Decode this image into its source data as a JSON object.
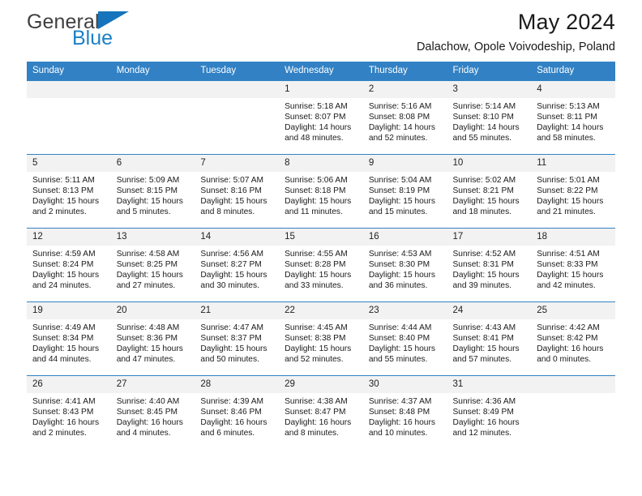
{
  "brand": {
    "name_top": "General",
    "name_bottom": "Blue",
    "triangle_color": "#1574bb",
    "top_color": "#3f3f3f",
    "bottom_color": "#1d80c6"
  },
  "header": {
    "title": "May 2024",
    "subtitle": "Dalachow, Opole Voivodeship, Poland"
  },
  "calendar": {
    "header_bg": "#3281c4",
    "header_text": "#ffffff",
    "daynum_bg": "#f2f2f2",
    "weekdays": [
      "Sunday",
      "Monday",
      "Tuesday",
      "Wednesday",
      "Thursday",
      "Friday",
      "Saturday"
    ],
    "labels": {
      "sunrise": "Sunrise:",
      "sunset": "Sunset:",
      "daylight": "Daylight:"
    },
    "weeks": [
      [
        {
          "day": "",
          "sunrise": "",
          "sunset": "",
          "daylight_line1": "",
          "daylight_line2": ""
        },
        {
          "day": "",
          "sunrise": "",
          "sunset": "",
          "daylight_line1": "",
          "daylight_line2": ""
        },
        {
          "day": "",
          "sunrise": "",
          "sunset": "",
          "daylight_line1": "",
          "daylight_line2": ""
        },
        {
          "day": "1",
          "sunrise": "Sunrise: 5:18 AM",
          "sunset": "Sunset: 8:07 PM",
          "daylight_line1": "Daylight: 14 hours",
          "daylight_line2": "and 48 minutes."
        },
        {
          "day": "2",
          "sunrise": "Sunrise: 5:16 AM",
          "sunset": "Sunset: 8:08 PM",
          "daylight_line1": "Daylight: 14 hours",
          "daylight_line2": "and 52 minutes."
        },
        {
          "day": "3",
          "sunrise": "Sunrise: 5:14 AM",
          "sunset": "Sunset: 8:10 PM",
          "daylight_line1": "Daylight: 14 hours",
          "daylight_line2": "and 55 minutes."
        },
        {
          "day": "4",
          "sunrise": "Sunrise: 5:13 AM",
          "sunset": "Sunset: 8:11 PM",
          "daylight_line1": "Daylight: 14 hours",
          "daylight_line2": "and 58 minutes."
        }
      ],
      [
        {
          "day": "5",
          "sunrise": "Sunrise: 5:11 AM",
          "sunset": "Sunset: 8:13 PM",
          "daylight_line1": "Daylight: 15 hours",
          "daylight_line2": "and 2 minutes."
        },
        {
          "day": "6",
          "sunrise": "Sunrise: 5:09 AM",
          "sunset": "Sunset: 8:15 PM",
          "daylight_line1": "Daylight: 15 hours",
          "daylight_line2": "and 5 minutes."
        },
        {
          "day": "7",
          "sunrise": "Sunrise: 5:07 AM",
          "sunset": "Sunset: 8:16 PM",
          "daylight_line1": "Daylight: 15 hours",
          "daylight_line2": "and 8 minutes."
        },
        {
          "day": "8",
          "sunrise": "Sunrise: 5:06 AM",
          "sunset": "Sunset: 8:18 PM",
          "daylight_line1": "Daylight: 15 hours",
          "daylight_line2": "and 11 minutes."
        },
        {
          "day": "9",
          "sunrise": "Sunrise: 5:04 AM",
          "sunset": "Sunset: 8:19 PM",
          "daylight_line1": "Daylight: 15 hours",
          "daylight_line2": "and 15 minutes."
        },
        {
          "day": "10",
          "sunrise": "Sunrise: 5:02 AM",
          "sunset": "Sunset: 8:21 PM",
          "daylight_line1": "Daylight: 15 hours",
          "daylight_line2": "and 18 minutes."
        },
        {
          "day": "11",
          "sunrise": "Sunrise: 5:01 AM",
          "sunset": "Sunset: 8:22 PM",
          "daylight_line1": "Daylight: 15 hours",
          "daylight_line2": "and 21 minutes."
        }
      ],
      [
        {
          "day": "12",
          "sunrise": "Sunrise: 4:59 AM",
          "sunset": "Sunset: 8:24 PM",
          "daylight_line1": "Daylight: 15 hours",
          "daylight_line2": "and 24 minutes."
        },
        {
          "day": "13",
          "sunrise": "Sunrise: 4:58 AM",
          "sunset": "Sunset: 8:25 PM",
          "daylight_line1": "Daylight: 15 hours",
          "daylight_line2": "and 27 minutes."
        },
        {
          "day": "14",
          "sunrise": "Sunrise: 4:56 AM",
          "sunset": "Sunset: 8:27 PM",
          "daylight_line1": "Daylight: 15 hours",
          "daylight_line2": "and 30 minutes."
        },
        {
          "day": "15",
          "sunrise": "Sunrise: 4:55 AM",
          "sunset": "Sunset: 8:28 PM",
          "daylight_line1": "Daylight: 15 hours",
          "daylight_line2": "and 33 minutes."
        },
        {
          "day": "16",
          "sunrise": "Sunrise: 4:53 AM",
          "sunset": "Sunset: 8:30 PM",
          "daylight_line1": "Daylight: 15 hours",
          "daylight_line2": "and 36 minutes."
        },
        {
          "day": "17",
          "sunrise": "Sunrise: 4:52 AM",
          "sunset": "Sunset: 8:31 PM",
          "daylight_line1": "Daylight: 15 hours",
          "daylight_line2": "and 39 minutes."
        },
        {
          "day": "18",
          "sunrise": "Sunrise: 4:51 AM",
          "sunset": "Sunset: 8:33 PM",
          "daylight_line1": "Daylight: 15 hours",
          "daylight_line2": "and 42 minutes."
        }
      ],
      [
        {
          "day": "19",
          "sunrise": "Sunrise: 4:49 AM",
          "sunset": "Sunset: 8:34 PM",
          "daylight_line1": "Daylight: 15 hours",
          "daylight_line2": "and 44 minutes."
        },
        {
          "day": "20",
          "sunrise": "Sunrise: 4:48 AM",
          "sunset": "Sunset: 8:36 PM",
          "daylight_line1": "Daylight: 15 hours",
          "daylight_line2": "and 47 minutes."
        },
        {
          "day": "21",
          "sunrise": "Sunrise: 4:47 AM",
          "sunset": "Sunset: 8:37 PM",
          "daylight_line1": "Daylight: 15 hours",
          "daylight_line2": "and 50 minutes."
        },
        {
          "day": "22",
          "sunrise": "Sunrise: 4:45 AM",
          "sunset": "Sunset: 8:38 PM",
          "daylight_line1": "Daylight: 15 hours",
          "daylight_line2": "and 52 minutes."
        },
        {
          "day": "23",
          "sunrise": "Sunrise: 4:44 AM",
          "sunset": "Sunset: 8:40 PM",
          "daylight_line1": "Daylight: 15 hours",
          "daylight_line2": "and 55 minutes."
        },
        {
          "day": "24",
          "sunrise": "Sunrise: 4:43 AM",
          "sunset": "Sunset: 8:41 PM",
          "daylight_line1": "Daylight: 15 hours",
          "daylight_line2": "and 57 minutes."
        },
        {
          "day": "25",
          "sunrise": "Sunrise: 4:42 AM",
          "sunset": "Sunset: 8:42 PM",
          "daylight_line1": "Daylight: 16 hours",
          "daylight_line2": "and 0 minutes."
        }
      ],
      [
        {
          "day": "26",
          "sunrise": "Sunrise: 4:41 AM",
          "sunset": "Sunset: 8:43 PM",
          "daylight_line1": "Daylight: 16 hours",
          "daylight_line2": "and 2 minutes."
        },
        {
          "day": "27",
          "sunrise": "Sunrise: 4:40 AM",
          "sunset": "Sunset: 8:45 PM",
          "daylight_line1": "Daylight: 16 hours",
          "daylight_line2": "and 4 minutes."
        },
        {
          "day": "28",
          "sunrise": "Sunrise: 4:39 AM",
          "sunset": "Sunset: 8:46 PM",
          "daylight_line1": "Daylight: 16 hours",
          "daylight_line2": "and 6 minutes."
        },
        {
          "day": "29",
          "sunrise": "Sunrise: 4:38 AM",
          "sunset": "Sunset: 8:47 PM",
          "daylight_line1": "Daylight: 16 hours",
          "daylight_line2": "and 8 minutes."
        },
        {
          "day": "30",
          "sunrise": "Sunrise: 4:37 AM",
          "sunset": "Sunset: 8:48 PM",
          "daylight_line1": "Daylight: 16 hours",
          "daylight_line2": "and 10 minutes."
        },
        {
          "day": "31",
          "sunrise": "Sunrise: 4:36 AM",
          "sunset": "Sunset: 8:49 PM",
          "daylight_line1": "Daylight: 16 hours",
          "daylight_line2": "and 12 minutes."
        },
        {
          "day": "",
          "sunrise": "",
          "sunset": "",
          "daylight_line1": "",
          "daylight_line2": ""
        }
      ]
    ]
  }
}
